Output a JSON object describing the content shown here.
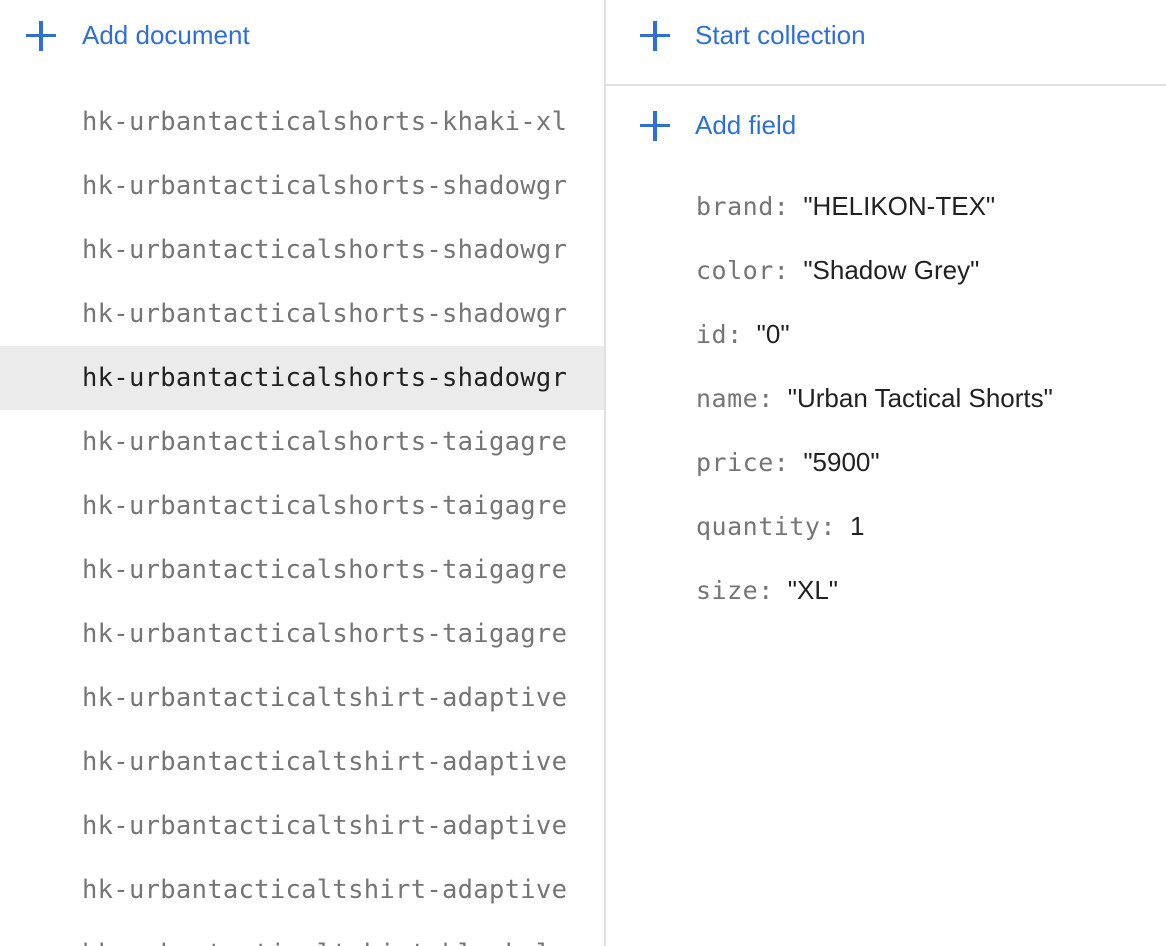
{
  "left_panel": {
    "add_document_label": "Add document",
    "documents": [
      {
        "id": "hk-urbantacticalshorts-khaki-xl",
        "selected": false
      },
      {
        "id": "hk-urbantacticalshorts-shadowgr",
        "selected": false
      },
      {
        "id": "hk-urbantacticalshorts-shadowgr",
        "selected": false
      },
      {
        "id": "hk-urbantacticalshorts-shadowgr",
        "selected": false
      },
      {
        "id": "hk-urbantacticalshorts-shadowgr",
        "selected": true
      },
      {
        "id": "hk-urbantacticalshorts-taigagre",
        "selected": false
      },
      {
        "id": "hk-urbantacticalshorts-taigagre",
        "selected": false
      },
      {
        "id": "hk-urbantacticalshorts-taigagre",
        "selected": false
      },
      {
        "id": "hk-urbantacticalshorts-taigagre",
        "selected": false
      },
      {
        "id": "hk-urbantacticaltshirt-adaptive",
        "selected": false
      },
      {
        "id": "hk-urbantacticaltshirt-adaptive",
        "selected": false
      },
      {
        "id": "hk-urbantacticaltshirt-adaptive",
        "selected": false
      },
      {
        "id": "hk-urbantacticaltshirt-adaptive",
        "selected": false
      },
      {
        "id": "hk-urbantacticaltshirt-black-l",
        "selected": false
      }
    ]
  },
  "right_panel": {
    "start_collection_label": "Start collection",
    "add_field_label": "Add field",
    "fields": [
      {
        "key": "brand:",
        "value": "\"HELIKON-TEX\""
      },
      {
        "key": "color:",
        "value": "\"Shadow Grey\""
      },
      {
        "key": "id:",
        "value": "\"0\""
      },
      {
        "key": "name:",
        "value": "\"Urban Tactical Shorts\""
      },
      {
        "key": "price:",
        "value": "\"5900\""
      },
      {
        "key": "quantity:",
        "value": "1"
      },
      {
        "key": "size:",
        "value": "\"XL\""
      }
    ]
  },
  "colors": {
    "accent": "#2f6fd6",
    "selected_row_bg": "#ebebeb",
    "muted_text": "#757575",
    "divider": "#e0e0e0"
  },
  "icons": {
    "add_document": "plus-icon",
    "start_collection": "plus-icon",
    "add_field": "plus-icon"
  }
}
